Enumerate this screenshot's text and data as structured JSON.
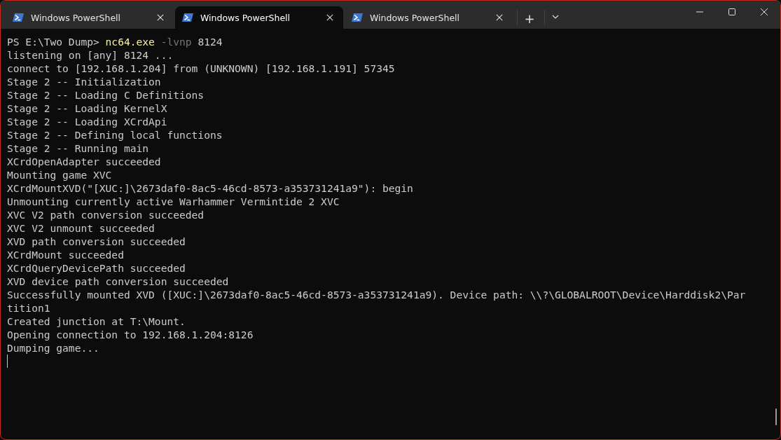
{
  "tabs": [
    {
      "title": "Windows PowerShell",
      "selected": false
    },
    {
      "title": "Windows PowerShell",
      "selected": true
    },
    {
      "title": "Windows PowerShell",
      "selected": false
    }
  ],
  "new_tab": "+",
  "terminal": {
    "prompt": {
      "path": "PS E:\\Two Dump>",
      "command": "nc64.exe",
      "flag": "-lvnp",
      "argument": "8124"
    },
    "lines": [
      "listening on [any] 8124 ...",
      "connect to [192.168.1.204] from (UNKNOWN) [192.168.1.191] 57345",
      "Stage 2 -- Initialization",
      "Stage 2 -- Loading C Definitions",
      "Stage 2 -- Loading KernelX",
      "Stage 2 -- Loading XCrdApi",
      "Stage 2 -- Defining local functions",
      "Stage 2 -- Running main",
      "XCrdOpenAdapter succeeded",
      "Mounting game XVC",
      "XCrdMountXVD(\"[XUC:]\\2673daf0-8ac5-46cd-8573-a353731241a9\"): begin",
      "Unmounting currently active Warhammer Vermintide 2 XVC",
      "XVC V2 path conversion succeeded",
      "XVC V2 unmount succeeded",
      "XVD path conversion succeeded",
      "XCrdMount succeeded",
      "XCrdQueryDevicePath succeeded",
      "XVD device path conversion succeeded",
      "Successfully mounted XVD ([XUC:]\\2673daf0-8ac5-46cd-8573-a353731241a9). Device path: \\\\?\\GLOBALROOT\\Device\\Harddisk2\\Par",
      "tition1",
      "Created junction at T:\\Mount.",
      "Opening connection to 192.168.1.204:8126",
      "Dumping game..."
    ]
  }
}
